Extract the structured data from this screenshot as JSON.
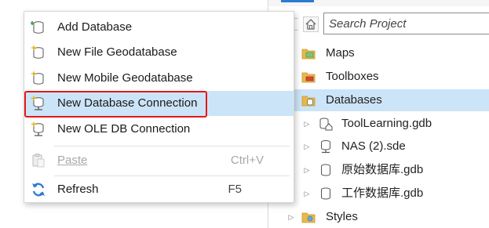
{
  "catalog": {
    "search_placeholder": "Search Project",
    "items": [
      {
        "label": "Maps",
        "icon": "folder-map-icon"
      },
      {
        "label": "Toolboxes",
        "icon": "folder-toolbox-icon"
      },
      {
        "label": "Databases",
        "icon": "folder-database-icon",
        "selected": true
      },
      {
        "label": "ToolLearning.gdb",
        "icon": "home-geodatabase-icon"
      },
      {
        "label": "NAS (2).sde",
        "icon": "database-connection-icon"
      },
      {
        "label": "原始数据库.gdb",
        "icon": "geodatabase-icon"
      },
      {
        "label": "工作数据库.gdb",
        "icon": "geodatabase-icon"
      },
      {
        "label": "Styles",
        "icon": "folder-styles-icon"
      }
    ]
  },
  "context_menu": {
    "items": [
      {
        "label": "Add Database",
        "icon": "add-database-icon"
      },
      {
        "label": "New File Geodatabase",
        "icon": "new-file-geodatabase-icon"
      },
      {
        "label": "New Mobile Geodatabase",
        "icon": "new-mobile-geodatabase-icon"
      },
      {
        "label": "New Database Connection",
        "icon": "new-database-connection-icon",
        "highlighted": true
      },
      {
        "label": "New OLE DB Connection",
        "icon": "new-ole-db-connection-icon"
      },
      {
        "label": "Paste",
        "shortcut": "Ctrl+V",
        "icon": "paste-icon",
        "disabled": true
      },
      {
        "label": "Refresh",
        "shortcut": "F5",
        "icon": "refresh-icon"
      }
    ]
  },
  "colors": {
    "selection": "#cce4f7",
    "highlight_outline": "#e81717",
    "accent": "#2b7bd1",
    "folder": "#e8b84a"
  }
}
